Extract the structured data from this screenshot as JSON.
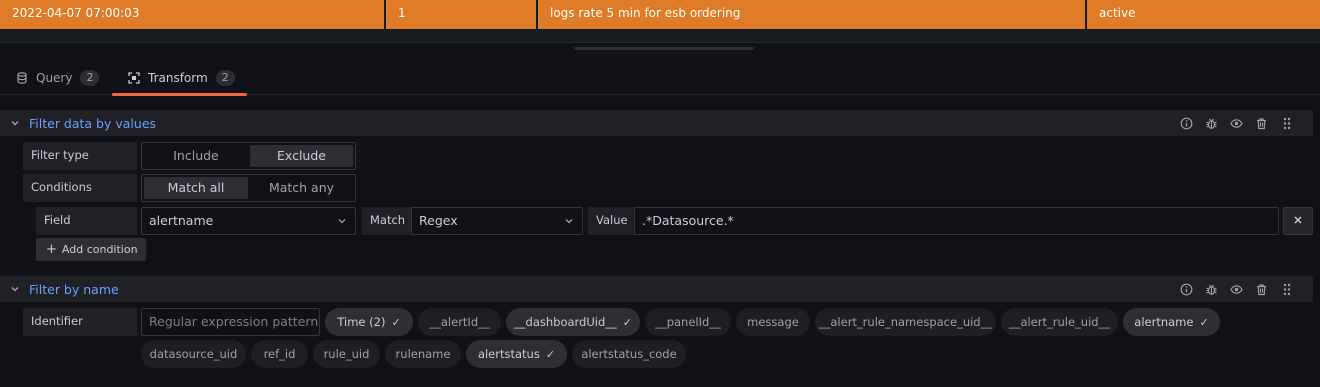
{
  "table_row": {
    "cells": [
      "2022-04-07 07:00:03",
      "1",
      "logs rate 5 min for esb ordering",
      "active"
    ]
  },
  "tabs": [
    {
      "label": "Query",
      "count": "2",
      "icon": "database-icon"
    },
    {
      "label": "Transform",
      "count": "2",
      "icon": "transform-icon"
    }
  ],
  "filter_values": {
    "title": "Filter data by values",
    "filter_type_label": "Filter type",
    "filter_type_options": [
      "Include",
      "Exclude"
    ],
    "filter_type_selected": "Exclude",
    "conditions_label": "Conditions",
    "conditions_options": [
      "Match all",
      "Match any"
    ],
    "conditions_selected": "Match all",
    "field_label": "Field",
    "field_value": "alertname",
    "match_label": "Match",
    "match_value": "Regex",
    "value_label": "Value",
    "value_value": ".*Datasource.*",
    "add_condition_label": "Add condition"
  },
  "filter_name": {
    "title": "Filter by name",
    "identifier_label": "Identifier",
    "regex_placeholder": "Regular expression pattern",
    "chips_row1": [
      {
        "label": "Time (2)",
        "selected": true
      },
      {
        "label": "__alertId__",
        "selected": false
      },
      {
        "label": "__dashboardUid__",
        "selected": true
      },
      {
        "label": "__panelId__",
        "selected": false
      },
      {
        "label": "message",
        "selected": false
      },
      {
        "label": "__alert_rule_namespace_uid__",
        "selected": false
      },
      {
        "label": "__alert_rule_uid__",
        "selected": false
      },
      {
        "label": "alertname",
        "selected": true
      }
    ],
    "chips_row2": [
      {
        "label": "datasource_uid",
        "selected": false
      },
      {
        "label": "ref_id",
        "selected": false
      },
      {
        "label": "rule_uid",
        "selected": false
      },
      {
        "label": "rulename",
        "selected": false
      },
      {
        "label": "alertstatus",
        "selected": true
      },
      {
        "label": "alertstatus_code",
        "selected": false
      }
    ]
  },
  "colors": {
    "accent_orange": "#e07b27",
    "tab_underline": "#f5653c",
    "title_blue": "#6e9fff"
  }
}
